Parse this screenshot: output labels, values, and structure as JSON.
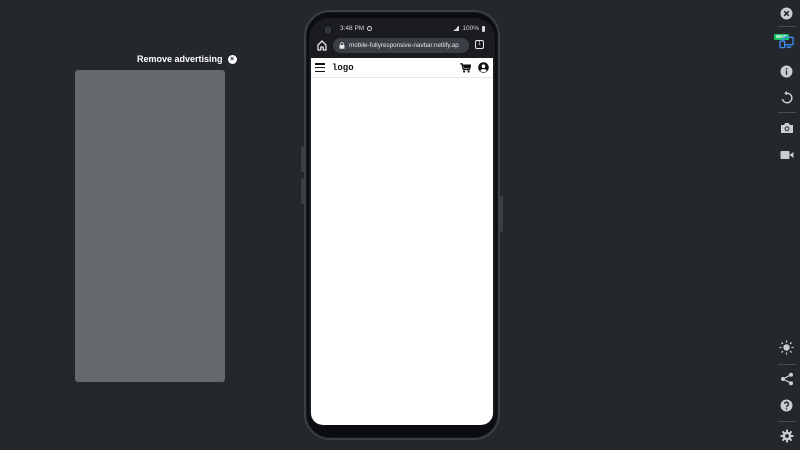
{
  "ad": {
    "remove_label": "Remove advertising",
    "close_glyph": "×"
  },
  "phone": {
    "status": {
      "time": "3:48 PM",
      "battery": "100%"
    },
    "browser": {
      "url": "mobile-fullyresponsive-navbar.netlify.ap",
      "tab_count": "1"
    },
    "site": {
      "logo": "logo"
    }
  },
  "toolbar": {
    "new_badge": "NEW"
  },
  "colors": {
    "background": "#24272c",
    "ad_placeholder": "#65686d",
    "url_pill": "#3b3f45",
    "new_badge": "#18c06a",
    "device_icon": "#3e8ff5"
  },
  "icons": {
    "toolbar": [
      "close-icon",
      "responsive-devices-icon",
      "info-icon",
      "rotate-icon",
      "screenshot-camera-icon",
      "video-record-icon",
      "brightness-icon",
      "share-icon",
      "help-icon",
      "settings-gear-icon"
    ],
    "site": [
      "hamburger-menu-icon",
      "shopping-cart-icon",
      "user-account-icon"
    ],
    "browser": [
      "home-icon",
      "lock-icon",
      "tabs-icon"
    ]
  }
}
